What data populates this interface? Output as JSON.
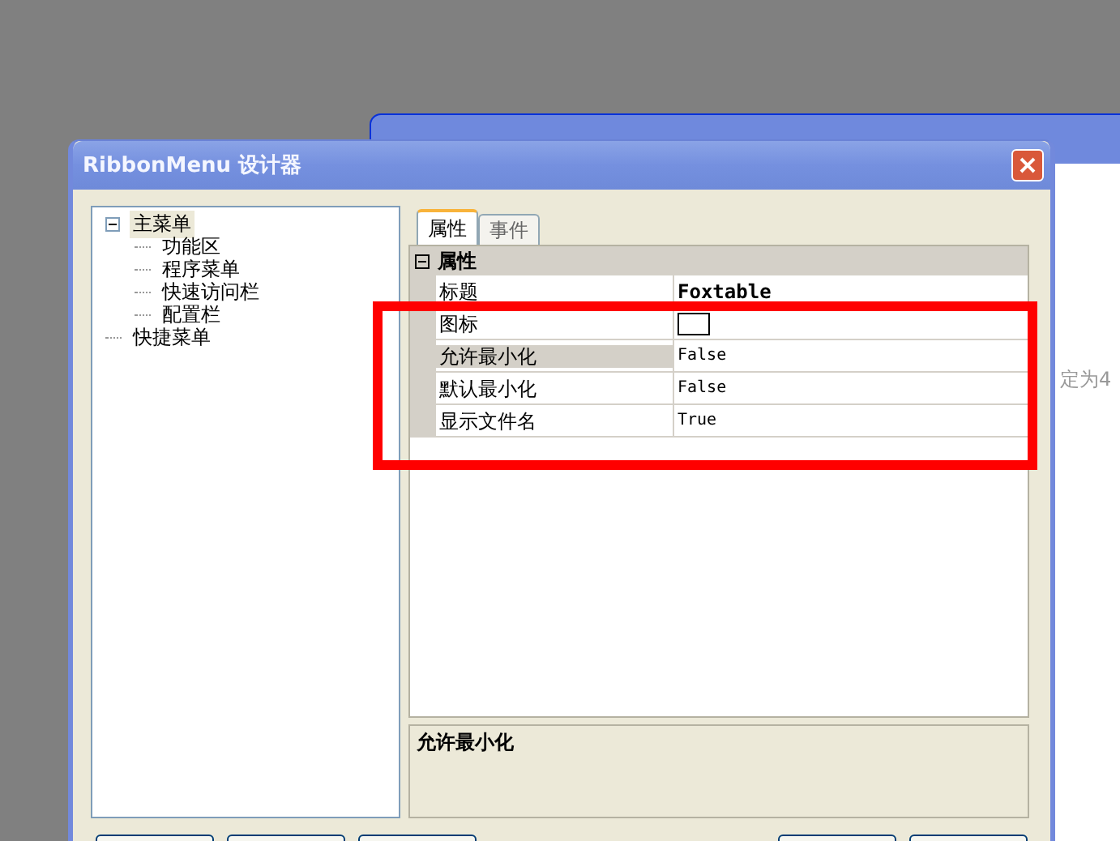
{
  "back_window": {
    "text": "定为4"
  },
  "window": {
    "title": "RibbonMenu 设计器"
  },
  "tree": [
    {
      "label": "主菜单",
      "expanded": true,
      "selected": true,
      "children": [
        {
          "label": "功能区"
        },
        {
          "label": "程序菜单"
        },
        {
          "label": "快速访问栏"
        },
        {
          "label": "配置栏"
        }
      ]
    },
    {
      "label": "快捷菜单",
      "selected": false
    }
  ],
  "tabs": [
    {
      "label": "属性",
      "selected": true
    },
    {
      "label": "事件",
      "selected": false
    }
  ],
  "property_grid": {
    "category": "属性",
    "expanded": true,
    "rows": [
      {
        "name": "标题",
        "kind": "text",
        "value": "Foxtable",
        "bold": true,
        "selected": false
      },
      {
        "name": "图标",
        "kind": "swatch",
        "selected": false
      },
      {
        "name": "允许最小化",
        "kind": "text",
        "value": "False",
        "bold": false,
        "selected": true
      },
      {
        "name": "默认最小化",
        "kind": "text",
        "value": "False",
        "bold": false,
        "selected": false
      },
      {
        "name": "显示文件名",
        "kind": "text",
        "value": "True",
        "bold": false,
        "selected": false
      }
    ]
  },
  "description": {
    "title": "允许最小化"
  }
}
